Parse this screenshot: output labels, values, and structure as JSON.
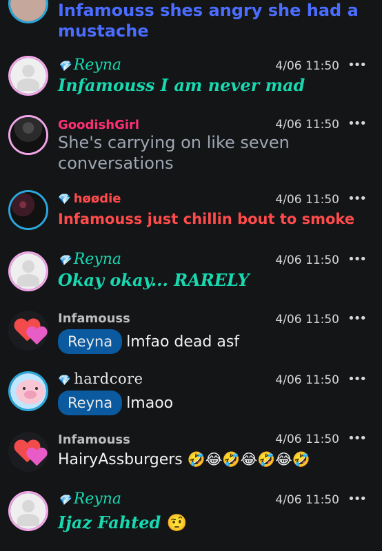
{
  "messages": [
    {
      "id": "m0",
      "avatar": "user-photo",
      "text": "Infamouss shes angry she had a mustache",
      "text_color": "#4a6dff"
    },
    {
      "id": "m1",
      "avatar": "default-avatar",
      "name": "Reyna",
      "badge_icon": "diamond-icon",
      "time": "4/06 11:50",
      "text": "Infamouss I am never mad",
      "text_color": "#18d8b0"
    },
    {
      "id": "m2",
      "avatar": "dark-photo",
      "name": "GoodishGirl",
      "time": "4/06 11:50",
      "text": "She's carrying on like seven conversations",
      "text_color": "#9da6b2"
    },
    {
      "id": "m3",
      "avatar": "smoke-photo",
      "name": "høødie",
      "badge_icon": "diamond-icon",
      "time": "4/06 11:50",
      "text": "Infamouss just chillin bout to smoke",
      "text_color": "#ff4b4b"
    },
    {
      "id": "m4",
      "avatar": "default-avatar",
      "name": "Reyna",
      "badge_icon": "diamond-icon",
      "time": "4/06 11:50",
      "text": "Okay okay... RARELY",
      "text_color": "#18d8b0"
    },
    {
      "id": "m5",
      "avatar": "hearts-icon",
      "name": "Infamouss",
      "time": "4/06 11:50",
      "mention": "Reyna",
      "text": "lmfao dead asf",
      "text_color": "#f2f2f2"
    },
    {
      "id": "m6",
      "avatar": "pig-icon",
      "name": "hardcore",
      "badge_icon": "diamond-icon",
      "time": "4/06 11:50",
      "mention": "Reyna",
      "text": "lmaoo",
      "text_color": "#f2f2f2"
    },
    {
      "id": "m7",
      "avatar": "hearts-icon",
      "name": "Infamouss",
      "time": "4/06 11:50",
      "text": "HairyAssburgers",
      "emojis": "🤣😂🤣😂🤣😂🤣",
      "text_color": "#f2f2f2"
    },
    {
      "id": "m8",
      "avatar": "default-avatar",
      "name": "Reyna",
      "badge_icon": "diamond-icon",
      "time": "4/06 11:50",
      "text": "Ijaz Fahted",
      "emoji": "🤨",
      "text_color": "#18d8b0"
    }
  ],
  "menu_icon": "more-icon",
  "menu_glyph": "•••",
  "diamond_glyph": "💎"
}
